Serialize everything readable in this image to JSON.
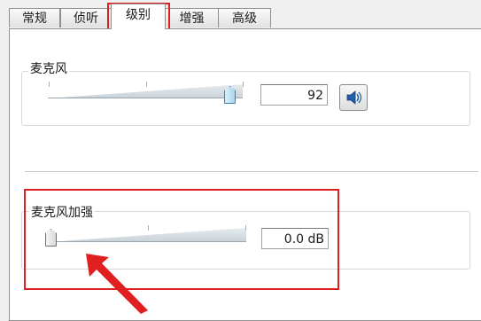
{
  "tabs": [
    {
      "label": "常规"
    },
    {
      "label": "侦听"
    },
    {
      "label": "级别",
      "selected": true
    },
    {
      "label": "增强"
    },
    {
      "label": "高级"
    }
  ],
  "microphone": {
    "label": "麦克风",
    "value_text": "92",
    "level_fraction": 0.92,
    "mute_button_icon": "speaker-icon"
  },
  "boost": {
    "label": "麦克风加强",
    "value_text": "0.0 dB",
    "level_fraction": 0.0
  },
  "annotations": {
    "highlight_color": "#e02020",
    "arrow_icon": "red-arrow-icon"
  }
}
